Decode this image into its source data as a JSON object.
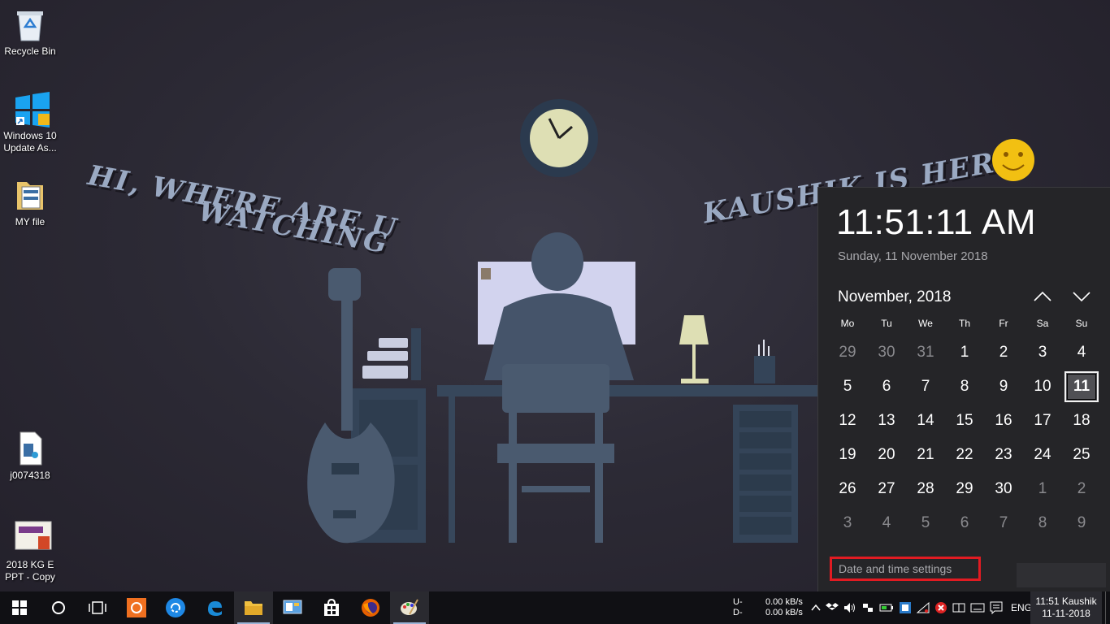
{
  "desktop": {
    "icons": [
      {
        "label": "Recycle Bin",
        "icon": "recycle-bin-icon"
      },
      {
        "label": "Windows 10 Update As...",
        "icon": "windows-logo-icon"
      },
      {
        "label": "MY file",
        "icon": "folder-icon"
      },
      {
        "label": "j0074318",
        "icon": "audio-file-icon"
      },
      {
        "label": "2018 KG E PPT - Copy",
        "icon": "powerpoint-file-icon"
      }
    ]
  },
  "wallpaper": {
    "text_left_line1": "HI, WHERE ARE U",
    "text_left_line2": "WATCHING",
    "text_right": "KAUSHIK IS HERE"
  },
  "flyout": {
    "time": "11:51:11 AM",
    "long_date": "Sunday, 11 November 2018",
    "month_title": "November, 2018",
    "weekdays": [
      "Mo",
      "Tu",
      "We",
      "Th",
      "Fr",
      "Sa",
      "Su"
    ],
    "weeks": [
      [
        "29",
        "30",
        "31",
        "1",
        "2",
        "3",
        "4"
      ],
      [
        "5",
        "6",
        "7",
        "8",
        "9",
        "10",
        "11"
      ],
      [
        "12",
        "13",
        "14",
        "15",
        "16",
        "17",
        "18"
      ],
      [
        "19",
        "20",
        "21",
        "22",
        "23",
        "24",
        "25"
      ],
      [
        "26",
        "27",
        "28",
        "29",
        "30",
        "1",
        "2"
      ],
      [
        "3",
        "4",
        "5",
        "6",
        "7",
        "8",
        "9"
      ]
    ],
    "today": "11",
    "settings_link": "Date and time settings",
    "highlight_color": "#e11b22"
  },
  "taskbar": {
    "apps": [
      {
        "name": "start-icon"
      },
      {
        "name": "cortana-icon"
      },
      {
        "name": "task-view-icon"
      },
      {
        "name": "orange-app-icon"
      },
      {
        "name": "sync-app-icon"
      },
      {
        "name": "edge-icon"
      },
      {
        "name": "file-explorer-icon"
      },
      {
        "name": "control-panel-icon"
      },
      {
        "name": "store-icon"
      },
      {
        "name": "firefox-icon"
      },
      {
        "name": "paint-icon"
      }
    ],
    "net_up_label": "U-",
    "net_down_label": "D-",
    "net_up_value": "0.00 kB/s",
    "net_down_value": "0.00 kB/s",
    "language": "ENG",
    "clock_time": "11:51 Kaushik",
    "clock_date": "11-11-2018"
  }
}
